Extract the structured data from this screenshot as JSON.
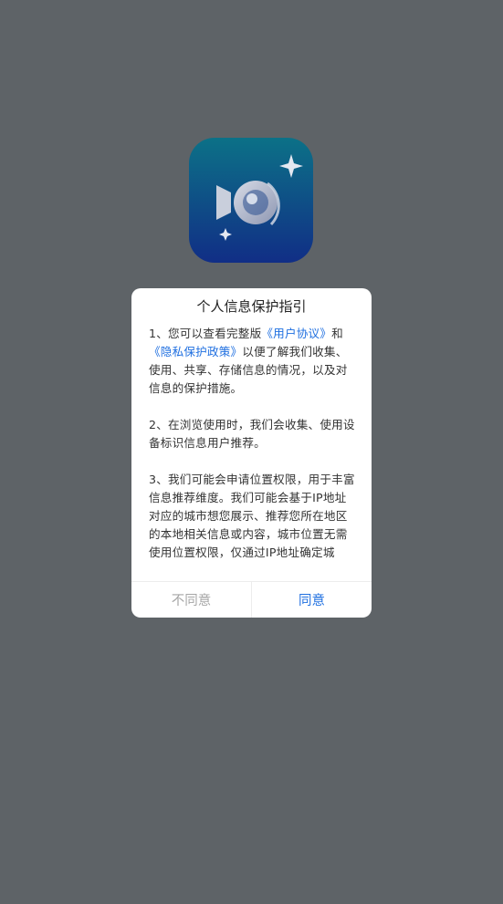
{
  "app": {
    "icon_name": "video-camera-app-icon",
    "gradient_top": "#0d6f86",
    "gradient_bottom": "#0f2f86"
  },
  "dialog": {
    "title": "个人信息保护指引",
    "p1": {
      "prefix": "1、您可以查看完整版",
      "link1": "《用户协议》",
      "middle": "和",
      "link2": "《隐私保护政策》",
      "suffix": "以便了解我们收集、使用、共享、存储信息的情况，以及对信息的保护措施。"
    },
    "p2": "2、在浏览使用时，我们会收集、使用设备标识信息用户推荐。",
    "p3": "3、我们可能会申请位置权限，用于丰富信息推荐维度。我们可能会基于IP地址对应的城市想您展示、推荐您所在地区的本地相关信息或内容，城市位置无需使用位置权限，仅通过IP地址确定城",
    "buttons": {
      "disagree": "不同意",
      "agree": "同意"
    }
  },
  "colors": {
    "overlay": "#5e6367",
    "link": "#1f6fe0",
    "disabled_text": "#a6a6a6"
  }
}
